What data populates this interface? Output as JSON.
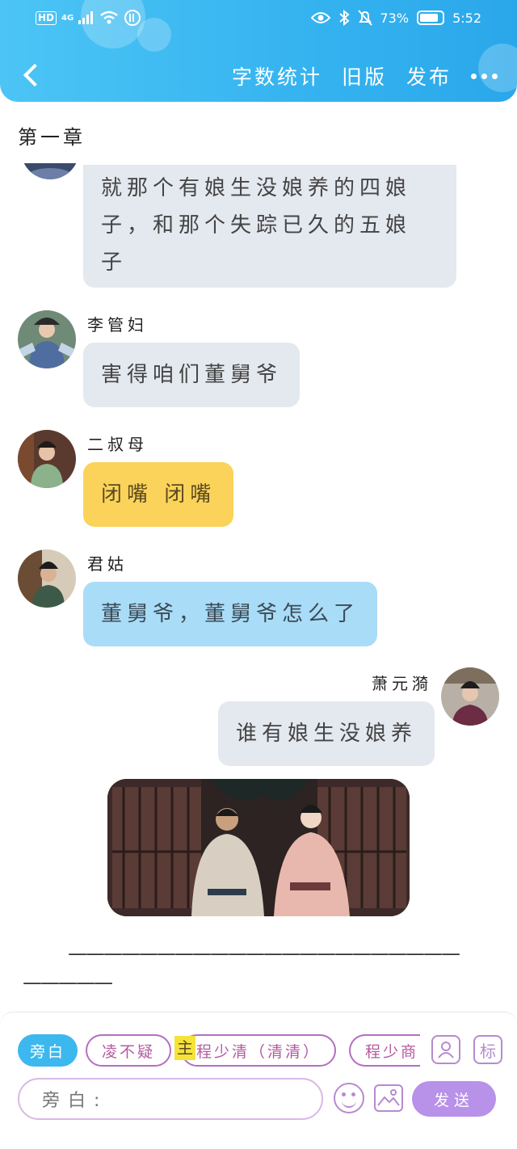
{
  "status_bar": {
    "network": "HD",
    "signal": "4G",
    "battery": "73%",
    "time": "5:52"
  },
  "header": {
    "word_count": "字数统计",
    "old_version": "旧版",
    "publish": "发布"
  },
  "chapter_title": "第一章",
  "messages": [
    {
      "speaker": "",
      "text_lines": [
        "就那个有娘生没娘养的四娘",
        "子，和那个失踪已久的五娘",
        "子"
      ]
    },
    {
      "speaker": "李管妇",
      "text": "害得咱们董舅爷"
    },
    {
      "speaker": "二叔母",
      "text": "闭嘴 闭嘴"
    },
    {
      "speaker": "君姑",
      "text": "董舅爷，董舅爷怎么了"
    },
    {
      "speaker": "萧元漪",
      "text": "谁有娘生没娘养"
    }
  ],
  "divider_line1": "——————————————————————",
  "divider_line2": "—————",
  "composer": {
    "chips": [
      "旁白",
      "凌不疑",
      "程少清（清清）",
      "程少商"
    ],
    "highlight_char": "主",
    "tag_label": "标",
    "input_placeholder": "旁白:",
    "send_label": "发送"
  },
  "colors": {
    "header": "#35b3f0",
    "gray_bubble": "#e4e8ef",
    "yellow_bubble": "#fbd35a",
    "blue_bubble": "#a9dcf7",
    "send": "#b891e8"
  }
}
